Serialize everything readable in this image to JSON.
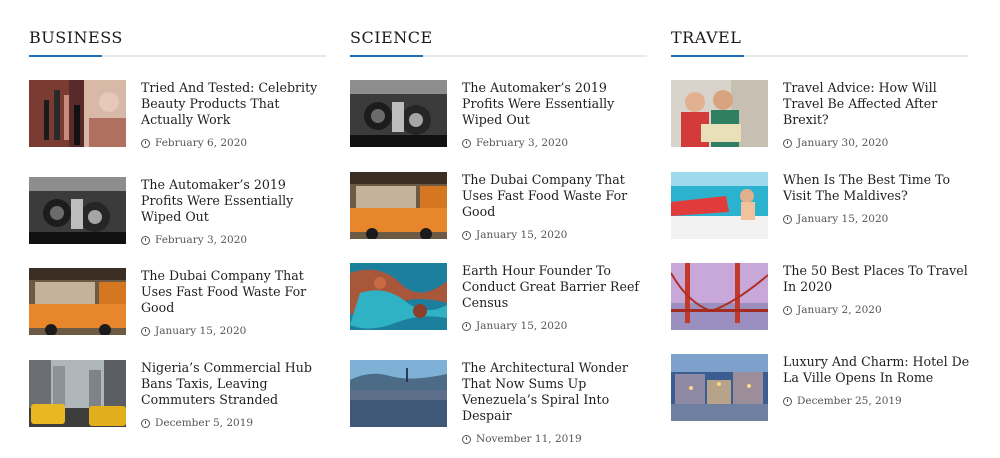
{
  "accent_color": "#1f6fb4",
  "columns": [
    {
      "title": "BUSINESS",
      "posts": [
        {
          "title": "Tried And Tested: Celebrity Beauty Products That Actually Work",
          "date": "February 6, 2020",
          "image": "makeup-brushes"
        },
        {
          "title": "The Automaker’s 2019 Profits Were Essentially Wiped Out",
          "date": "February 3, 2020",
          "image": "car-engine"
        },
        {
          "title": "The Dubai Company That Uses Fast Food Waste For Good",
          "date": "January 15, 2020",
          "image": "food-truck"
        },
        {
          "title": "Nigeria’s Commercial Hub Bans Taxis, Leaving Commuters Stranded",
          "date": "December 5, 2019",
          "image": "city-taxis"
        }
      ]
    },
    {
      "title": "SCIENCE",
      "posts": [
        {
          "title": "The Automaker’s 2019 Profits Were Essentially Wiped Out",
          "date": "February 3, 2020",
          "image": "car-engine"
        },
        {
          "title": "The Dubai Company That Uses Fast Food Waste For Good",
          "date": "January 15, 2020",
          "image": "food-truck"
        },
        {
          "title": "Earth Hour Founder To Conduct Great Barrier Reef Census",
          "date": "January 15, 2020",
          "image": "reef-aerial"
        },
        {
          "title": "The Architectural Wonder That Now Sums Up Venezuela’s Spiral Into Despair",
          "date": "November 11, 2019",
          "image": "city-hills"
        }
      ]
    },
    {
      "title": "TRAVEL",
      "posts": [
        {
          "title": "Travel Advice: How Will Travel Be Affected After Brexit?",
          "date": "January 30, 2020",
          "image": "tourists-map"
        },
        {
          "title": "When Is The Best Time To Visit The Maldives?",
          "date": "January 15, 2020",
          "image": "boat-beach"
        },
        {
          "title": "The 50 Best Places To Travel In 2020",
          "date": "January 2, 2020",
          "image": "golden-gate"
        },
        {
          "title": "Luxury And Charm: Hotel De La Ville Opens In Rome",
          "date": "December 25, 2019",
          "image": "rome-night"
        }
      ]
    }
  ]
}
